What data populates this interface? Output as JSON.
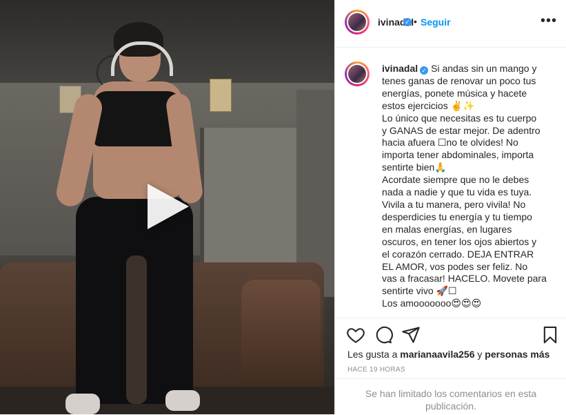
{
  "post": {
    "username": "ivinadal",
    "follow_label": "Seguir",
    "more_label": "•••",
    "caption_lines": [
      "Si andas sin un mango y",
      "tenes ganas de renovar un poco tus",
      "energías, ponete música y hacete",
      "estos ejercicios ✌️✨",
      "Lo único que necesitas es tu cuerpo",
      "y GANAS de estar mejor. De adentro",
      "hacia afuera ☐no te olvides! No",
      "importa tener abdominales, importa",
      "sentirte bien🙏",
      "Acordate siempre que no le debes",
      "nada a nadie y que tu vida es tuya.",
      "Vivila a tu manera, pero vivila! No",
      "desperdicies tu energía y tu tiempo",
      "en malas energías, en lugares",
      "oscuros, en tener los ojos abiertos y",
      "el corazón cerrado. DEJA ENTRAR",
      "EL AMOR, vos podes ser feliz. No",
      "vas a fracasar! HACELO. Movete para",
      "sentirte vivo 🚀☐",
      "Los amooooooo😍😍😍"
    ],
    "likes_prefix": "Les gusta a ",
    "likes_user": "marianaavila256",
    "likes_middle": " y ",
    "likes_others": "personas más",
    "time_ago": "HACE 19 HORAS",
    "comments_limited": "Se han limitado los comentarios en esta publicación."
  },
  "icons": {
    "verified": "verified-badge-icon",
    "like": "heart-icon",
    "comment": "comment-icon",
    "share": "share-icon",
    "save": "bookmark-icon",
    "play": "play-icon"
  },
  "colors": {
    "accent": "#0095f6",
    "verified": "#3897f0",
    "muted": "#8e8e8e",
    "text": "#262626"
  }
}
